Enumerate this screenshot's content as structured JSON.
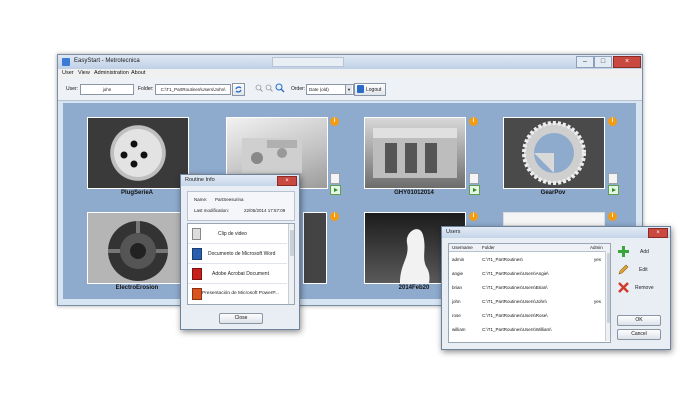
{
  "app": {
    "title": "EasyStart - Metrotecnica"
  },
  "menu": [
    "User",
    "View",
    "Administration",
    "About"
  ],
  "toolbar": {
    "user_label": "User:",
    "user_value": "john",
    "folder_label": "Folder:",
    "folder_value": "C:\\T1_PartRoutines\\Users\\John\\",
    "order_label": "Order:",
    "order_value": "Date (old)",
    "logout_label": "Logout"
  },
  "parts": [
    {
      "name": "PlugSerieA"
    },
    {
      "name": ""
    },
    {
      "name": "GHY01012014"
    },
    {
      "name": "GearPov"
    },
    {
      "name": "ElectroErosion"
    },
    {
      "name": ""
    },
    {
      "name": "2014Feb20"
    },
    {
      "name": ""
    }
  ],
  "routine_info": {
    "title": "Routine Info",
    "name_label": "Name:",
    "name_value": "PartSeesurina",
    "last_mod_label": "Last modification:",
    "last_mod_value": "22/05/2014 17:57:09",
    "attachments": [
      {
        "label": "Clip de video",
        "icon": "video-file-icon"
      },
      {
        "label": "Documento de Microsoft Word",
        "icon": "word-file-icon"
      },
      {
        "label": "Adobe Acrobat Document",
        "icon": "pdf-file-icon"
      },
      {
        "label": "Presentación de Microsoft PowerP...",
        "icon": "powerpoint-file-icon"
      }
    ],
    "close_label": "Close"
  },
  "users_dialog": {
    "title": "Users",
    "headers": [
      "Username",
      "Folder",
      "Admin"
    ],
    "rows": [
      {
        "username": "admin",
        "folder": "C:\\T1_PartRoutines\\",
        "admin": "yes"
      },
      {
        "username": "angie",
        "folder": "C:\\T1_PartRoutines\\Users\\Angie\\",
        "admin": ""
      },
      {
        "username": "brian",
        "folder": "C:\\T1_PartRoutines\\Users\\Brian\\",
        "admin": ""
      },
      {
        "username": "john",
        "folder": "C:\\T1_PartRoutines\\Users\\John\\",
        "admin": "yes"
      },
      {
        "username": "rose",
        "folder": "C:\\T1_PartRoutines\\Users\\Rose\\",
        "admin": ""
      },
      {
        "username": "william",
        "folder": "C:\\T1_PartRoutines\\Users\\William\\",
        "admin": ""
      }
    ],
    "add_label": "Add",
    "edit_label": "Edit",
    "remove_label": "Remove",
    "ok_label": "OK",
    "cancel_label": "Cancel"
  }
}
